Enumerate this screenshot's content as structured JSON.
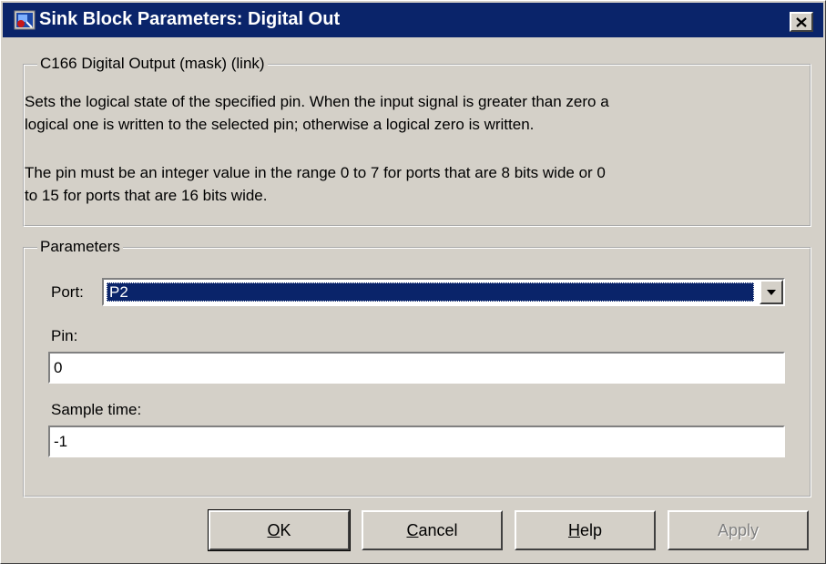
{
  "window": {
    "title": "Sink Block Parameters: Digital Out",
    "close_label": "✕"
  },
  "mask_group": {
    "title": "C166 Digital Output (mask) (link)",
    "lines": [
      "Sets the logical state of the specified pin. When the input signal is greater than zero a",
      "logical one is written to the selected pin; otherwise a logical zero is written.",
      "The pin must be an integer value in the range 0 to 7 for ports that are 8 bits wide or 0",
      "to 15 for ports that are 16 bits wide."
    ]
  },
  "params_group": {
    "title": "Parameters",
    "port": {
      "label": "Port:",
      "value": "P2"
    },
    "pin": {
      "label": "Pin:",
      "value": "0"
    },
    "sample_time": {
      "label": "Sample time:",
      "value": "-1"
    }
  },
  "buttons": {
    "ok": {
      "mnemonic": "O",
      "rest": "K"
    },
    "cancel": {
      "mnemonic": "C",
      "rest": "ancel"
    },
    "help": {
      "mnemonic": "H",
      "rest": "elp"
    },
    "apply": {
      "label": "Apply",
      "enabled": false
    }
  },
  "icons": {
    "app": "simulink-block-icon",
    "close": "close-icon",
    "dropdown": "chevron-down-icon"
  }
}
